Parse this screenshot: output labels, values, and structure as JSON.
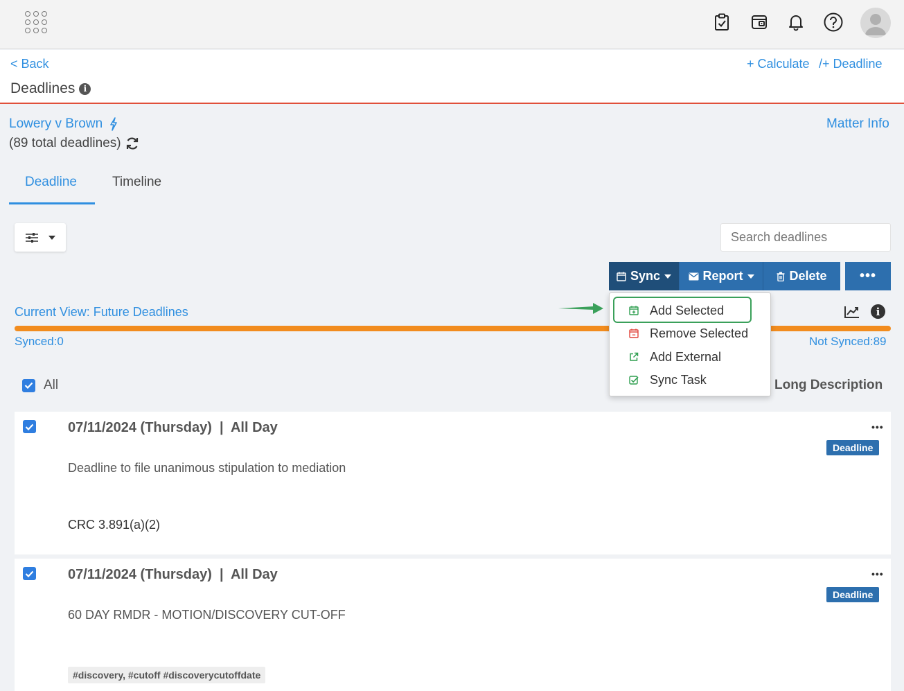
{
  "topbar": {
    "icons": [
      "apps-grid-icon",
      "tasks-clipboard-icon",
      "calendar-wallet-icon",
      "bell-icon",
      "help-icon",
      "user-avatar-icon"
    ]
  },
  "header": {
    "back": "< Back",
    "title": "Deadlines",
    "calculate": "+ Calculate",
    "add_deadline": "/+ Deadline"
  },
  "matter": {
    "name": "Lowery v Brown",
    "count": "(89 total deadlines)",
    "info_link": "Matter Info"
  },
  "tabs": [
    {
      "label": "Deadline",
      "active": true
    },
    {
      "label": "Timeline",
      "active": false
    }
  ],
  "search": {
    "placeholder": "Search deadlines"
  },
  "toolbar": {
    "sync": "Sync",
    "report": "Report",
    "delete": "Delete",
    "more": "•••"
  },
  "sync_menu": {
    "items": [
      {
        "label": "Add Selected",
        "icon": "calendar-plus-icon",
        "color": "#2e9e4f"
      },
      {
        "label": "Remove Selected",
        "icon": "calendar-minus-icon",
        "color": "#e0433a"
      },
      {
        "label": "Add External",
        "icon": "external-link-icon",
        "color": "#2e9e4f"
      },
      {
        "label": "Sync Task",
        "icon": "check-square-icon",
        "color": "#2e9e4f"
      }
    ]
  },
  "view": {
    "current": "Current View: Future Deadlines",
    "synced": "Synced:0",
    "not_synced": "Not Synced:89",
    "synced_fraction": 0
  },
  "list": {
    "all_label": "All",
    "long_desc_header": "Long Description"
  },
  "deadlines": [
    {
      "date": "07/11/2024 (Thursday)  |  All Day",
      "badge": "Deadline",
      "description": "Deadline to file unanimous stipulation to mediation",
      "rule": "CRC 3.891(a)(2)",
      "dots": "•••"
    },
    {
      "date": "07/11/2024 (Thursday)  |  All Day",
      "badge": "Deadline",
      "description": "60 DAY RMDR - MOTION/DISCOVERY CUT-OFF",
      "tags": "#discovery, #cutoff #discoverycutoffdate",
      "dots": "•••"
    }
  ],
  "colors": {
    "accent": "#2f8fe0",
    "sync_button": "#1f4e79",
    "button": "#2d6fae",
    "progress": "#f28c1e",
    "header_rule": "#e0503a",
    "highlight": "#3aa05a"
  }
}
